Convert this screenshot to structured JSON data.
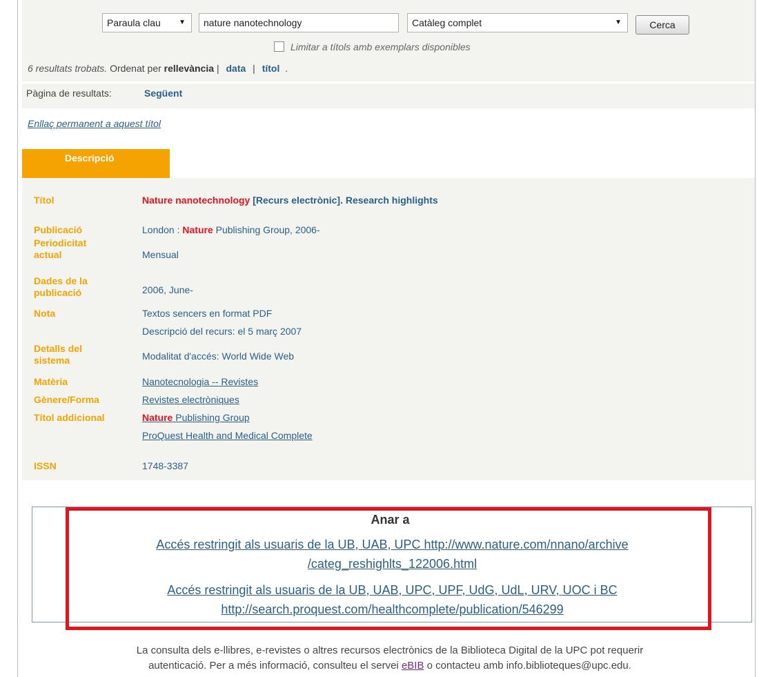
{
  "search": {
    "type_select": "Paraula clau",
    "query": "nature nanotechnology",
    "catalog_select": "Catàleg complet",
    "button": "Cerca",
    "limit_label": "Limitar a títols amb exemplars disponibles"
  },
  "results": {
    "count_text": "6 resultats trobats.",
    "sort_prefix": "Ordenat per",
    "sort_current": "rellevància",
    "sep1": "|",
    "sort_data": "data",
    "sep2": "|",
    "sort_title": "títol",
    "trailing": "."
  },
  "pagination": {
    "label": "Pàgina de resultats:",
    "next": "Següent"
  },
  "permalink": "Enllaç permanent a aquest títol",
  "tab": "Descripció",
  "record": {
    "title_label": "Títol",
    "title_red": "Nature nanotechnology",
    "title_rest": "[Recurs electrònic]. Research highlights",
    "pub_label": "Publicació",
    "pub_pre": "London :",
    "pub_red": "Nature",
    "pub_post": "Publishing Group, 2006-",
    "period_label_1": "Periodicitat",
    "period_label_2": "actual",
    "period_value": "Mensual",
    "dates_label_1": "Dades de la",
    "dates_label_2": "publicació",
    "dates_value": "2006, June-",
    "note_label": "Nota",
    "note_1": "Textos sencers en format PDF",
    "note_2": "Descripció del recurs: el 5 març 2007",
    "system_label_1": "Detalls del",
    "system_label_2": "sistema",
    "system_value": "Modalitat d'accés: World Wide Web",
    "subject_label": "Matèria",
    "subject_value": "Nanotecnologia -- Revistes",
    "genre_label": "Gènere/Forma",
    "genre_value": "Revistes electròniques",
    "addtitle_label": "Títol addicional",
    "addtitle_red": "Nature",
    "addtitle_rest": "Publishing Group",
    "addtitle_2": "ProQuest Health and Medical Complete",
    "issn_label": "ISSN",
    "issn_value": "1748-3387"
  },
  "goto": {
    "title": "Anar a",
    "link1_line1": "Accés restringit als usuaris de la UB, UAB, UPC http://www.nature.com/nnano/archive",
    "link1_line2": "/categ_reshighlts_122006.html",
    "link2_line1": "Accés restringit als usuaris de la UB, UAB, UPC, UPF, UdG, UdL, URV, UOC i BC",
    "link2_line2": "http://search.proquest.com/healthcomplete/publication/546299"
  },
  "footer": {
    "line1": "La consulta dels e-llibres, e-revistes o altres recursos electrònics de la Biblioteca Digital de la UPC pot requerir",
    "line2_pre": "autenticació. Per a més informació, consulteu el servei",
    "ebib": "eBIB",
    "line2_post": "o contacteu amb info.biblioteques@upc.edu."
  },
  "colors": {
    "accent": "#f5a300",
    "link": "#2a5f8a",
    "highlight_red": "#e3141c",
    "panel_bg": "#f3f3f0"
  }
}
